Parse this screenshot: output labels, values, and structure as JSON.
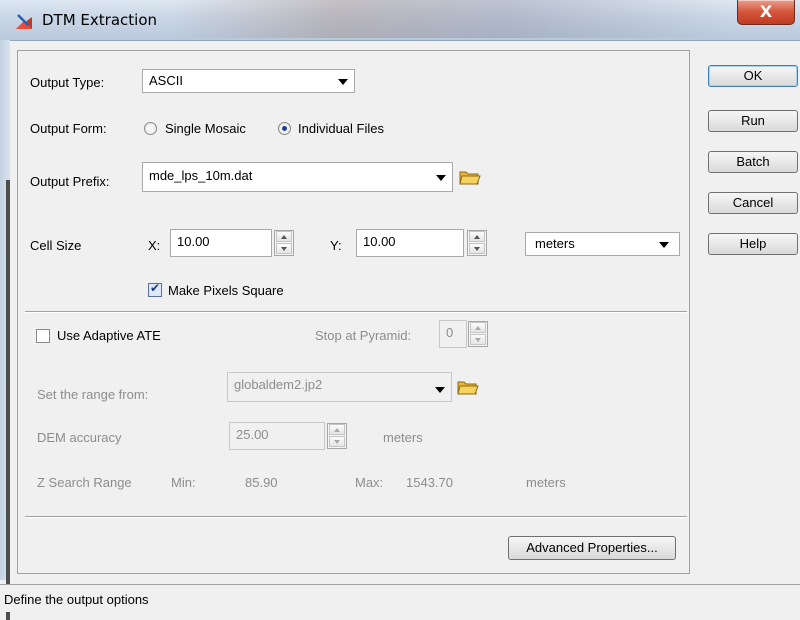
{
  "window": {
    "title": "DTM Extraction",
    "close_symbol": "X"
  },
  "buttons": {
    "ok": "OK",
    "run": "Run",
    "batch": "Batch",
    "cancel": "Cancel",
    "help": "Help"
  },
  "output": {
    "type_label": "Output Type:",
    "type_value": "ASCII",
    "form_label": "Output Form:",
    "form_options": [
      "Single Mosaic",
      "Individual Files"
    ],
    "form_selected": "Individual Files",
    "prefix_label": "Output Prefix:",
    "prefix_value": "mde_lps_10m.dat"
  },
  "cell_size": {
    "label": "Cell Size",
    "x_label": "X:",
    "x_value": "10.00",
    "y_label": "Y:",
    "y_value": "10.00",
    "units": "meters",
    "square_label": "Make Pixels Square",
    "square_checked": true
  },
  "adaptive": {
    "checkbox_label": "Use Adaptive ATE",
    "checked": false,
    "stop_label": "Stop at Pyramid:",
    "stop_value": "0",
    "range_label": "Set the range from:",
    "range_value": "globaldem2.jp2",
    "accuracy_label": "DEM accuracy",
    "accuracy_value": "25.00",
    "accuracy_units": "meters",
    "z_label": "Z Search Range",
    "min_label": "Min:",
    "min_value": "85.90",
    "max_label": "Max:",
    "max_value": "1543.70",
    "z_units": "meters"
  },
  "advanced_button": "Advanced Properties...",
  "status": "Define the output options"
}
